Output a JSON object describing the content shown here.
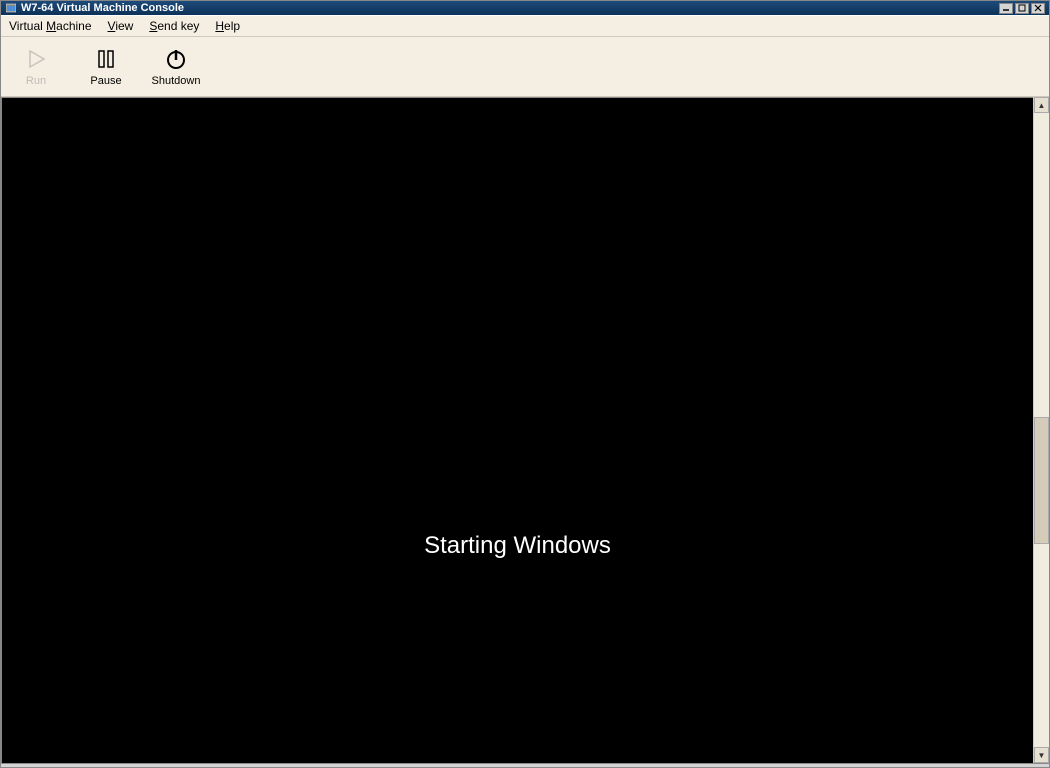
{
  "window": {
    "title": "W7-64 Virtual Machine Console"
  },
  "menu": {
    "virtual_machine": "Virtual Machine",
    "view": "View",
    "send_key": "Send key",
    "help": "Help"
  },
  "toolbar": {
    "run": "Run",
    "pause": "Pause",
    "shutdown": "Shutdown"
  },
  "vm": {
    "boot_message": "Starting Windows"
  }
}
